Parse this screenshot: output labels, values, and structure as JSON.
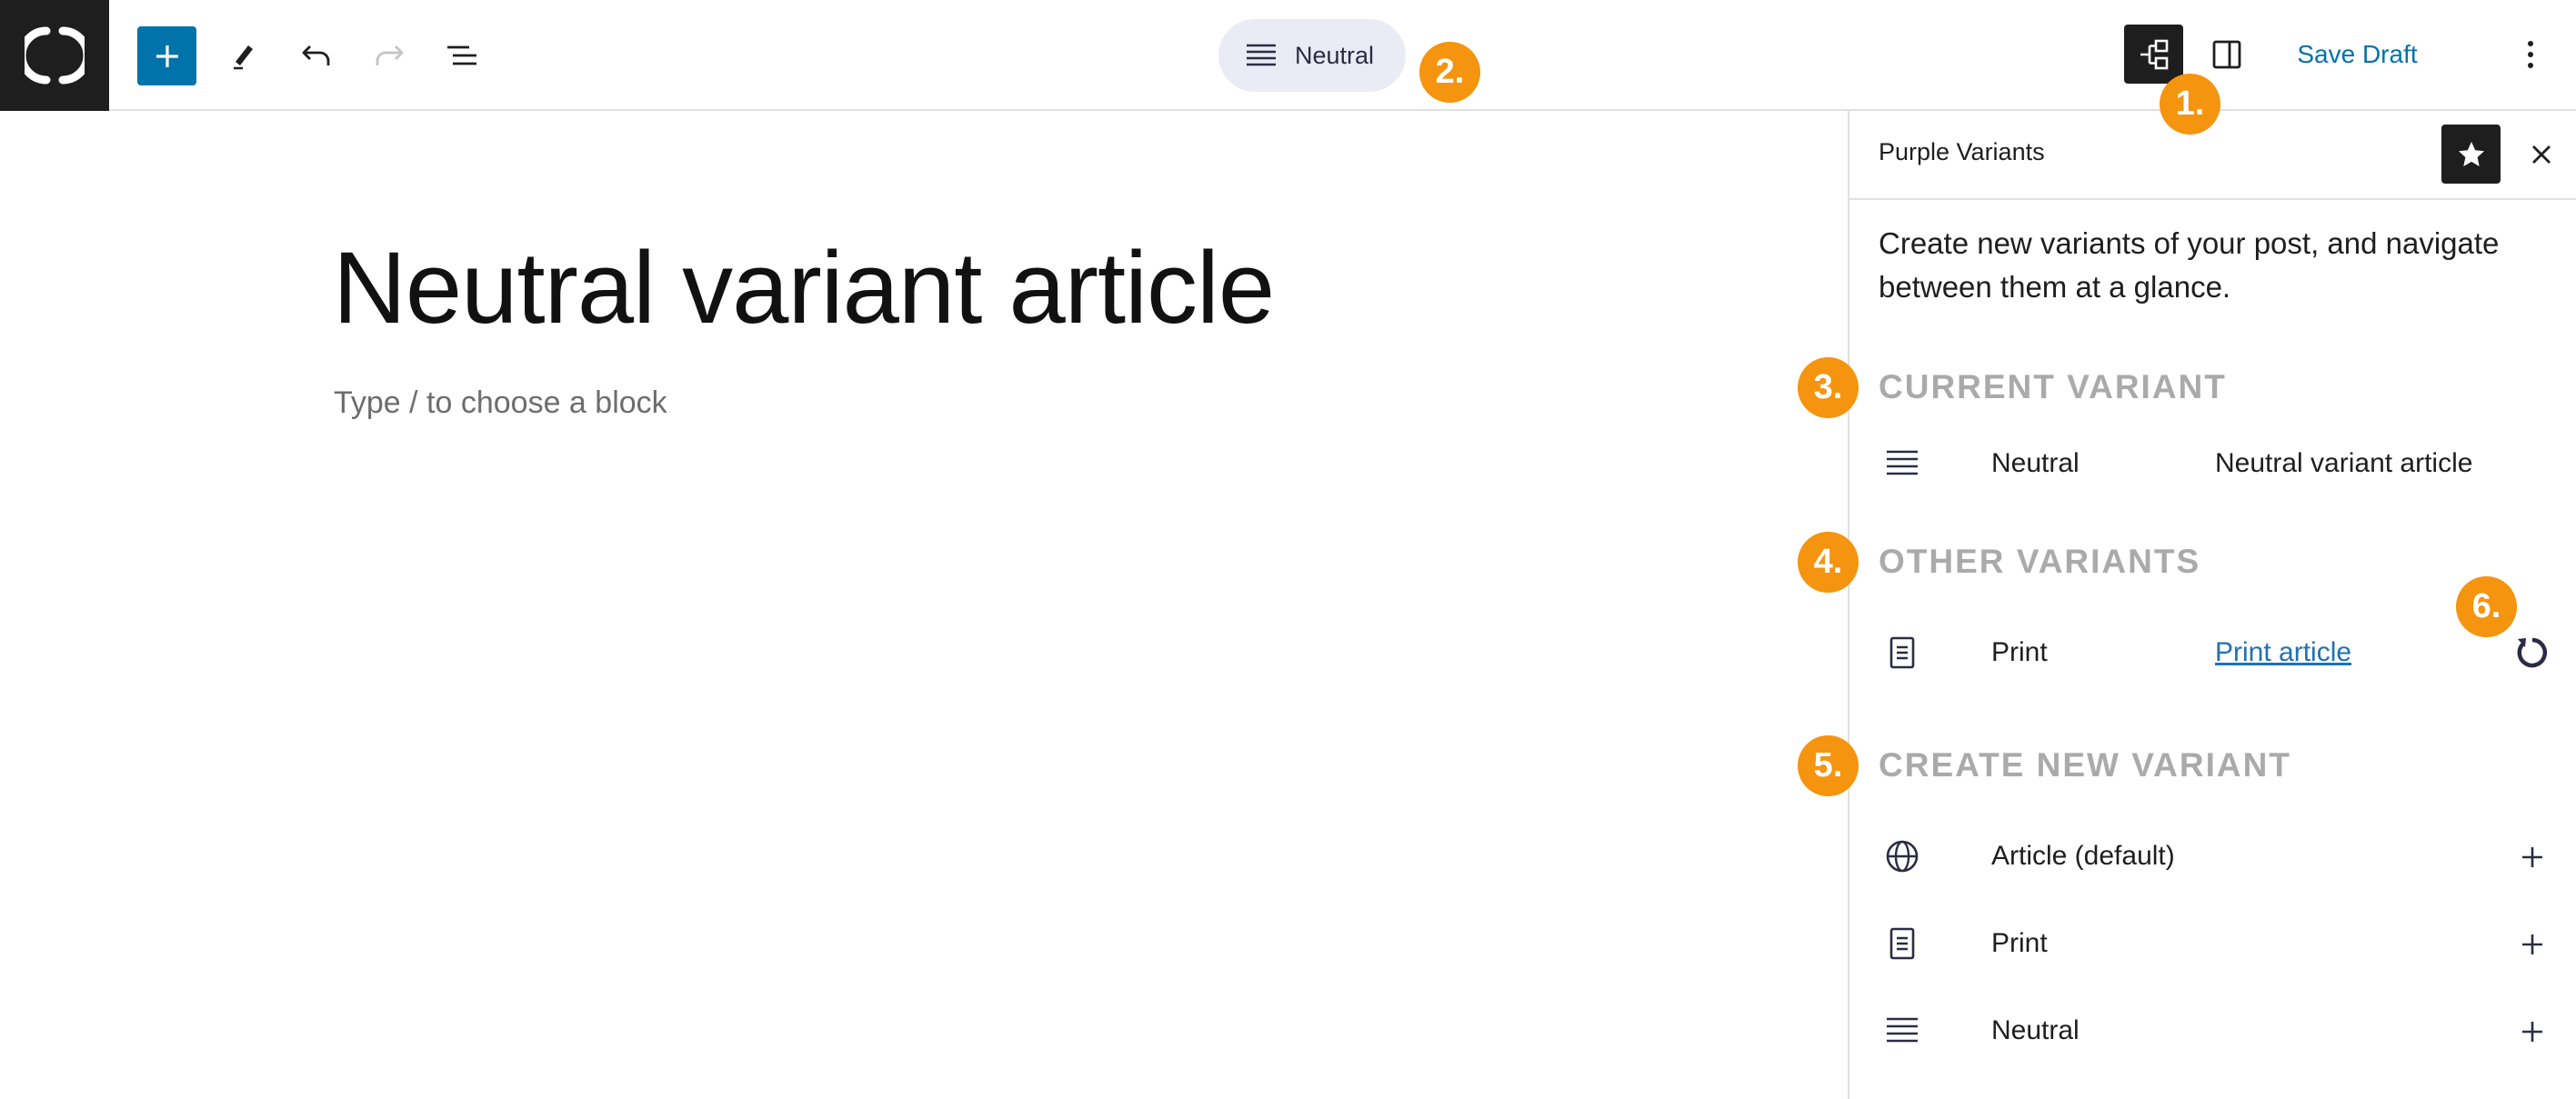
{
  "topbar": {
    "logo_icon": "wordpress-w-logo",
    "tools": {
      "inserter_icon": "plus-icon",
      "edit_icon": "pencil-icon",
      "undo_icon": "undo-icon",
      "redo_icon": "redo-icon",
      "list_view_icon": "list-view-icon"
    },
    "variant_switcher": {
      "icon": "align-justify-icon",
      "label": "Neutral"
    },
    "plugin_icon": "variants-tree-icon",
    "settings_icon": "sidebar-toggle-icon",
    "save_draft_label": "Save Draft",
    "options_icon": "vertical-ellipsis-icon"
  },
  "editor": {
    "post_title": "Neutral variant article",
    "block_placeholder": "Type / to choose a block"
  },
  "sidebar": {
    "title": "Purple Variants",
    "description": "Create new variants of your post, and navigate between them at a glance.",
    "current_variant": {
      "heading": "CURRENT VARIANT",
      "item": {
        "icon": "align-justify-icon",
        "name": "Neutral",
        "post_title": "Neutral variant article"
      }
    },
    "other_variants": {
      "heading": "OTHER VARIANTS",
      "items": [
        {
          "icon": "document-icon",
          "name": "Print",
          "link_text": "Print article",
          "action_icon": "sync-icon"
        }
      ]
    },
    "create_new_variant": {
      "heading": "CREATE NEW VARIANT",
      "items": [
        {
          "icon": "globe-icon",
          "name": "Article (default)",
          "action_icon": "plus-icon"
        },
        {
          "icon": "document-icon",
          "name": "Print",
          "action_icon": "plus-icon"
        },
        {
          "icon": "align-justify-icon",
          "name": "Neutral",
          "action_icon": "plus-icon"
        }
      ]
    }
  },
  "annotations": [
    "1.",
    "2.",
    "3.",
    "4.",
    "5.",
    "6."
  ],
  "colors": {
    "accent_blue": "#0073aa",
    "link_blue": "#2271b1",
    "badge_orange": "#f5940f",
    "section_heading_gray": "#aaaaaa",
    "pill_background": "#ebebf5",
    "dark": "#1e1e1e"
  }
}
